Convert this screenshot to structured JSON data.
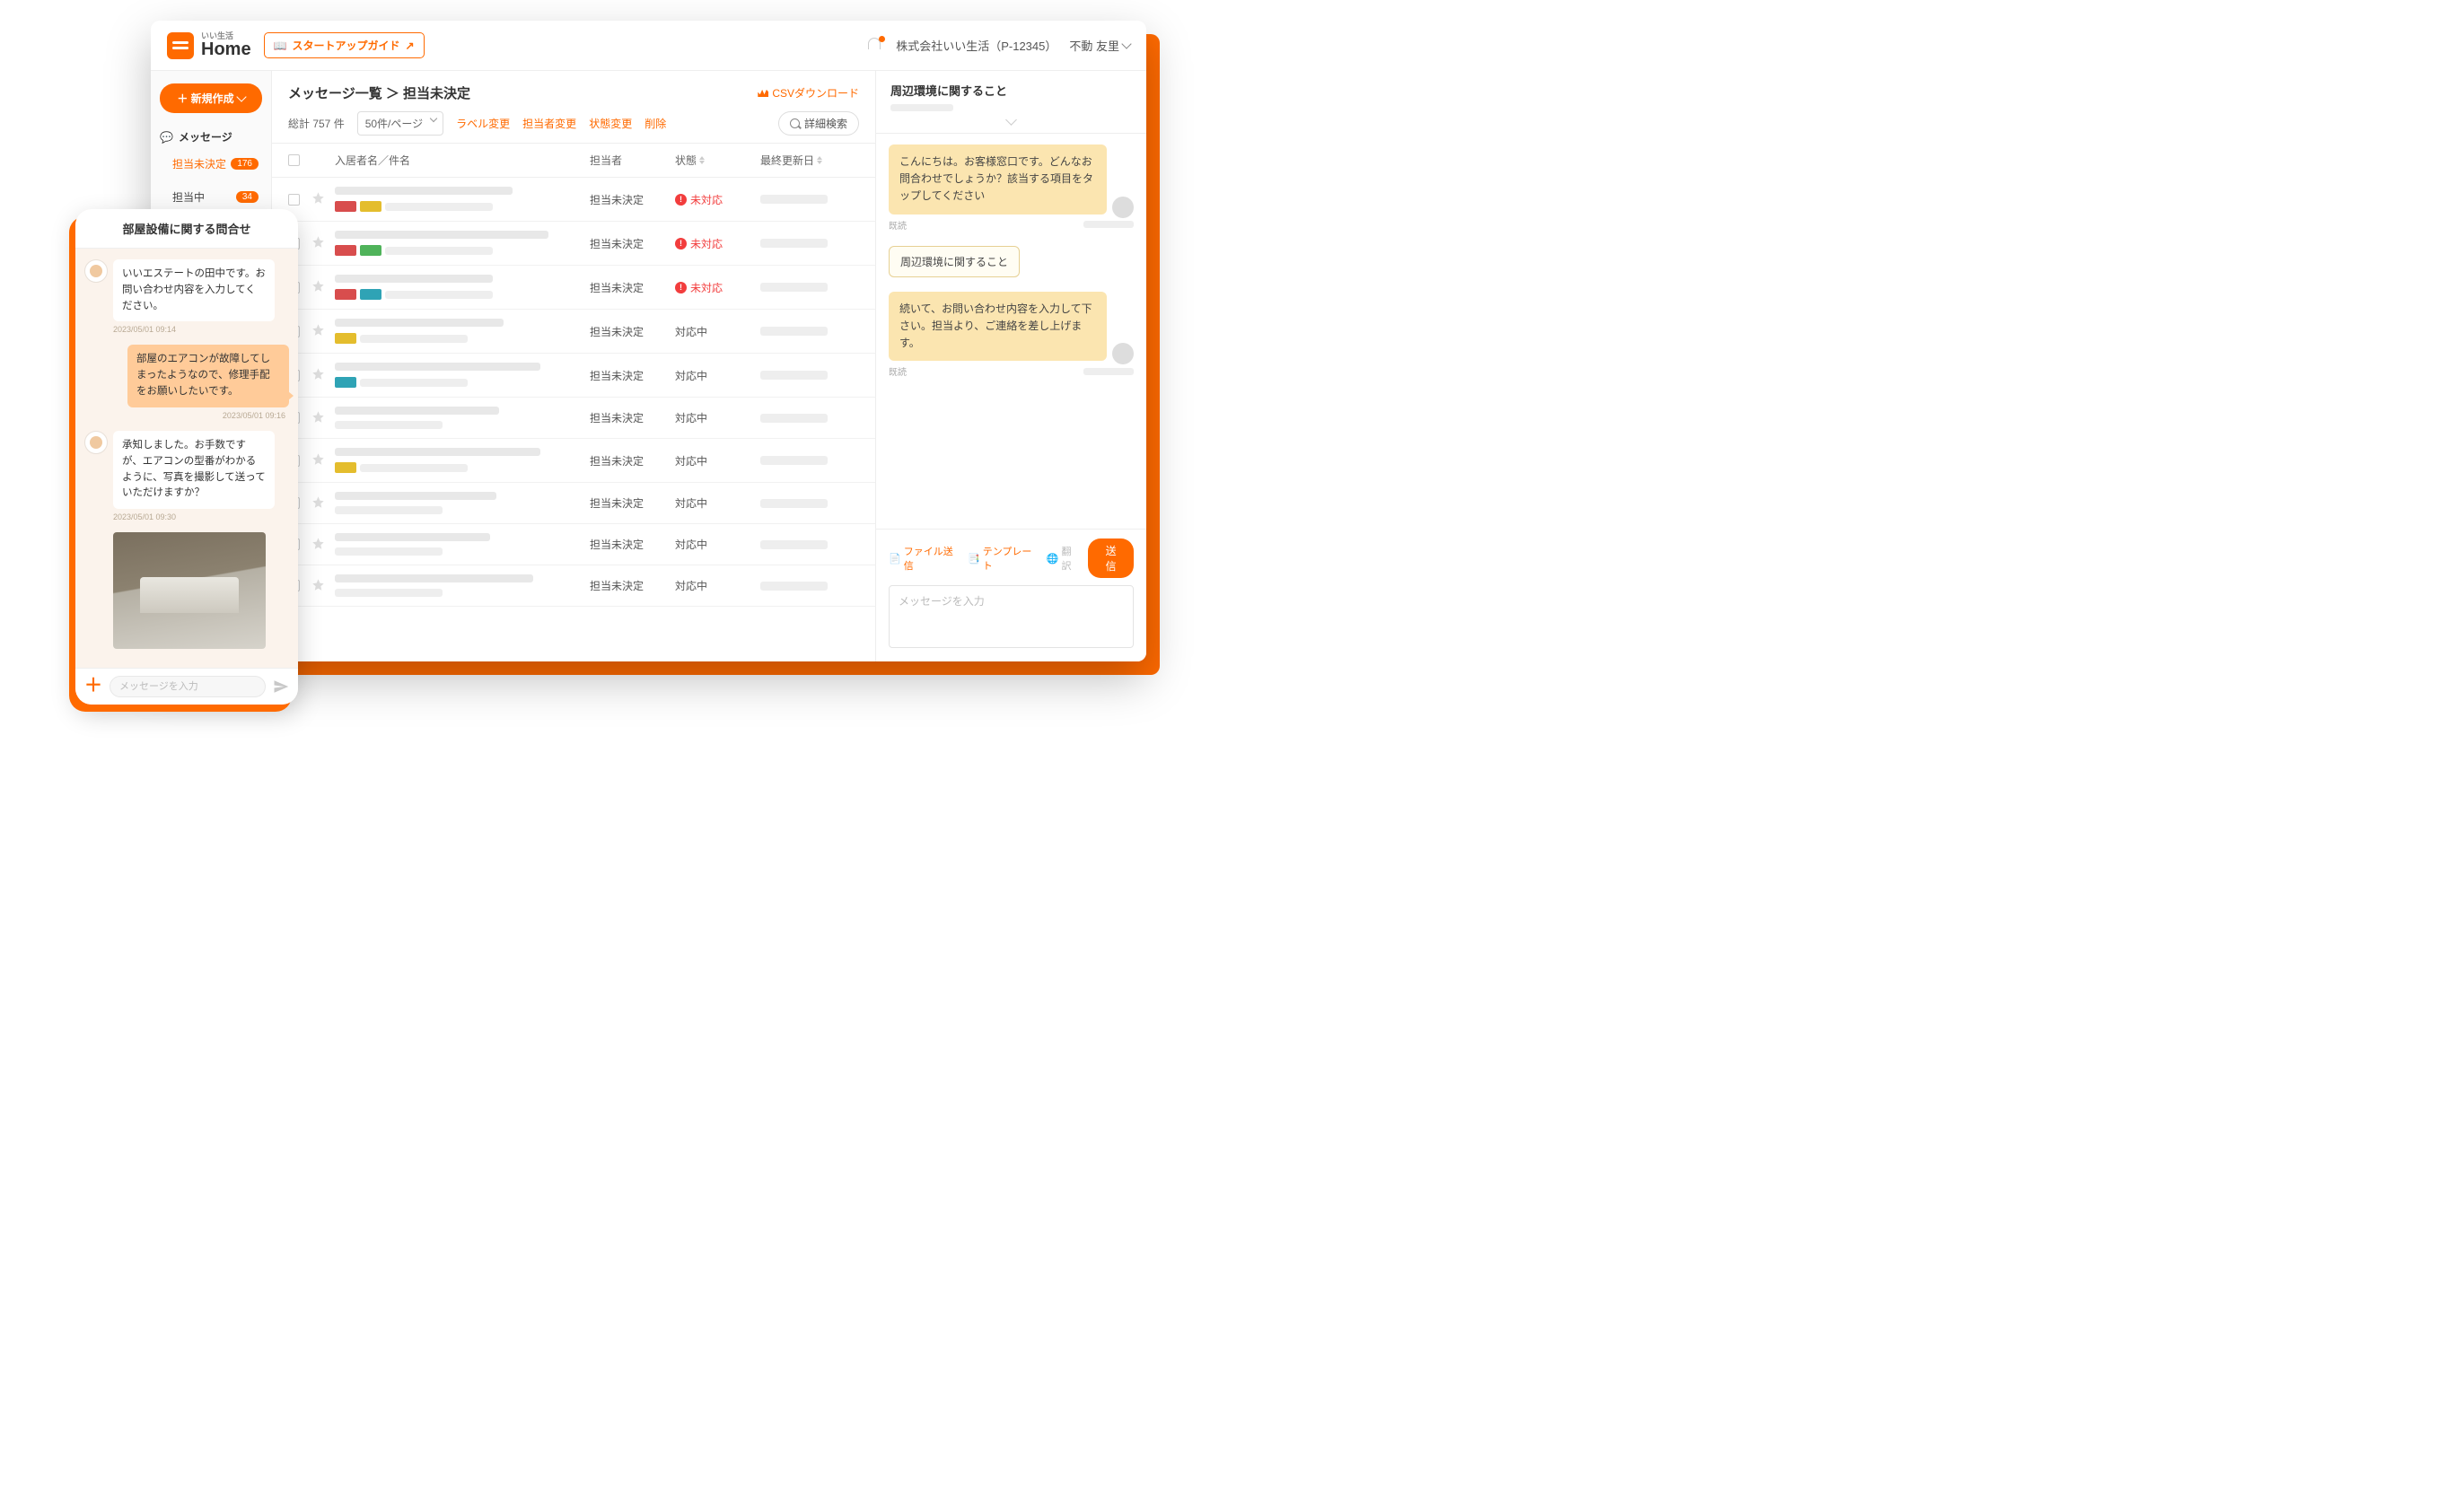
{
  "brand": {
    "sub": "いい生活",
    "main": "Home"
  },
  "startup_guide": "スタートアップガイド",
  "org_name": "株式会社いい生活（P-12345）",
  "user_name": "不動 友里",
  "nav": {
    "new_button": "＋ 新規作成",
    "section": "メッセージ",
    "items": [
      {
        "label": "担当未決定",
        "count": "176"
      },
      {
        "label": "担当中",
        "count": "34"
      }
    ]
  },
  "list": {
    "title": "メッセージ一覧 ＞ 担当未決定",
    "csv": "CSVダウンロード",
    "total": "総計 757 件",
    "per_page": "50件/ページ",
    "toolbar": {
      "label": "ラベル変更",
      "assignee": "担当者変更",
      "status": "状態変更",
      "delete": "削除"
    },
    "search": "詳細検索",
    "columns": {
      "name": "入居者名／件名",
      "assignee": "担当者",
      "status": "状態",
      "updated": "最終更新日"
    },
    "statuses": {
      "pending": "未対応",
      "in_progress": "対応中"
    },
    "assignee_value": "担当未決定",
    "rows": [
      {
        "tags": [
          "#d84d4d",
          "#e4bd2d"
        ],
        "status": "pending"
      },
      {
        "tags": [
          "#d84d4d",
          "#4fb35a"
        ],
        "status": "pending"
      },
      {
        "tags": [
          "#d84d4d",
          "#2fa3b5"
        ],
        "status": "pending"
      },
      {
        "tags": [
          "#e4bd2d"
        ],
        "status": "in_progress"
      },
      {
        "tags": [
          "#2fa3b5"
        ],
        "status": "in_progress"
      },
      {
        "tags": [],
        "status": "in_progress"
      },
      {
        "tags": [
          "#e4bd2d"
        ],
        "status": "in_progress"
      },
      {
        "tags": [],
        "status": "in_progress"
      },
      {
        "tags": [],
        "status": "in_progress"
      },
      {
        "tags": [],
        "status": "in_progress"
      }
    ]
  },
  "right": {
    "title": "周辺環境に関すること",
    "sys1": "こんにちは。お客様窓口です。どんなお問合わせでしょうか？該当する項目をタップしてください",
    "read": "既読",
    "choice": "周辺環境に関すること",
    "sys2": "続いて、お問い合わせ内容を入力して下さい。担当より、ご連絡を差し上げます。",
    "foot": {
      "file": "ファイル送信",
      "template": "テンプレート",
      "translate": "翻訳",
      "send": "送信"
    },
    "placeholder": "メッセージを入力"
  },
  "mobile": {
    "title": "部屋設備に関する問合せ",
    "m1": "いいエステートの田中です。お問い合わせ内容を入力してください。",
    "t1": "2023/05/01 09:14",
    "m2": "部屋のエアコンが故障してしまったようなので、修理手配をお願いしたいです。",
    "t2": "2023/05/01 09:16",
    "m3": "承知しました。お手数ですが、エアコンの型番がわかるように、写真を撮影して送っていただけますか？",
    "t3": "2023/05/01 09:30",
    "placeholder": "メッセージを入力"
  }
}
